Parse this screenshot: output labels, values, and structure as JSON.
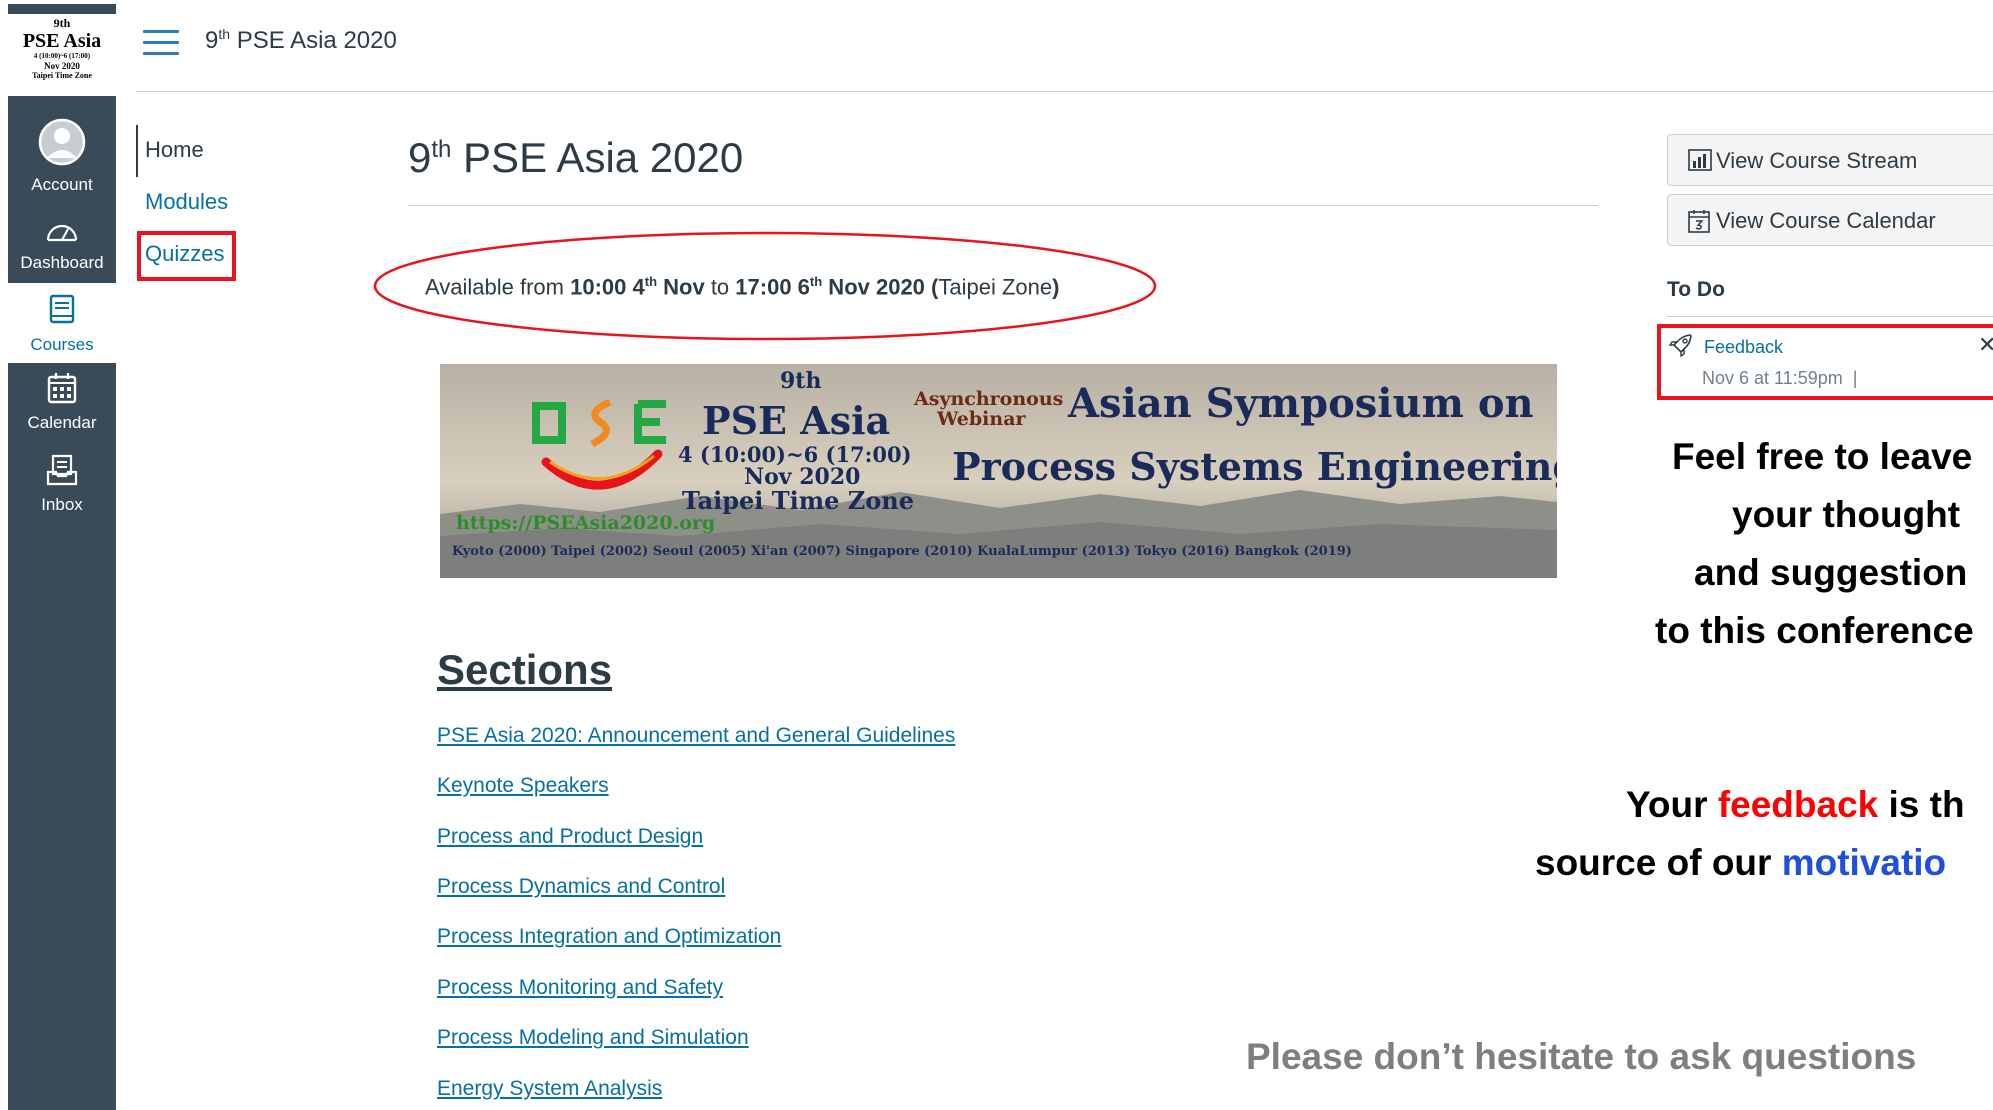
{
  "global_nav": {
    "logo": {
      "line1": "9th",
      "line2": "PSE Asia",
      "line3": "4 (10:00)~6 (17:00)",
      "line4": "Nov 2020",
      "line5": "Taipei Time Zone"
    },
    "items": [
      {
        "label": "Account",
        "icon": "account-icon"
      },
      {
        "label": "Dashboard",
        "icon": "dashboard-icon"
      },
      {
        "label": "Courses",
        "icon": "courses-icon"
      },
      {
        "label": "Calendar",
        "icon": "calendar-icon"
      },
      {
        "label": "Inbox",
        "icon": "inbox-icon"
      }
    ]
  },
  "header": {
    "breadcrumb": {
      "pre": "9",
      "sup": "th",
      "post": " PSE Asia 2020"
    }
  },
  "course_nav": {
    "items": [
      {
        "label": "Home"
      },
      {
        "label": "Modules"
      },
      {
        "label": "Quizzes"
      }
    ]
  },
  "main": {
    "title": {
      "pre": "9",
      "sup": "th",
      "post": " PSE Asia 2020"
    },
    "availability": {
      "prefix": "Available from ",
      "start_time": "10:00 4",
      "start_sup": "th",
      "start_month": " Nov",
      "middle": " to ",
      "end_time": "17:00 6",
      "end_sup": "th",
      "end_month": " Nov 2020",
      "paren_open": " (",
      "zone": "Taipei Zone",
      "paren_close": ")"
    },
    "banner": {
      "logo_text": "PSE",
      "ordinal": "9th",
      "name": "PSE Asia",
      "dates": "4 (10:00)~6 (17:00)",
      "month": "Nov 2020",
      "zone": "Taipei Time Zone",
      "async1": "Asynchronous",
      "async2": "Webinar",
      "symposium": "Asian Symposium on",
      "engineering": "Process Systems Engineering",
      "url": "https://PSEAsia2020.org",
      "history": "Kyoto (2000)  Taipei (2002)  Seoul (2005)  Xi'an (2007)  Singapore (2010)  KualaLumpur (2013)  Tokyo (2016)  Bangkok (2019)"
    },
    "sections_heading": "Sections",
    "section_links": [
      "PSE Asia 2020: Announcement and General Guidelines",
      "Keynote Speakers",
      "Process and Product Design",
      "Process Dynamics and Control",
      "Process Integration and Optimization",
      "Process Monitoring and Safety",
      "Process Modeling and Simulation",
      "Energy System Analysis"
    ]
  },
  "sidebar": {
    "buttons": [
      {
        "label": "View Course Stream",
        "icon": "stream-icon"
      },
      {
        "label": "View Course Calendar",
        "icon": "calendar-icon"
      }
    ],
    "todo_heading": "To Do",
    "todo_item": {
      "title": "Feedback",
      "date": "Nov 6 at 11:59pm",
      "separator": "|"
    }
  },
  "annotations": {
    "note1": [
      "Feel free to leave",
      "your thought",
      "and suggestion",
      "to this conference"
    ],
    "note2_line1_pre": "Your ",
    "note2_line1_red": "feedback",
    "note2_line1_post": " is th",
    "note2_line2_pre": "source of our ",
    "note2_line2_blue": "motivatio",
    "note3": "Please don’t hesitate to ask questions"
  },
  "colors": {
    "nav_bg": "#394b58",
    "link": "#0770a3",
    "highlight_red": "#e8141b",
    "note_red": "#ff0000",
    "note_blue": "#1f4fe0"
  }
}
